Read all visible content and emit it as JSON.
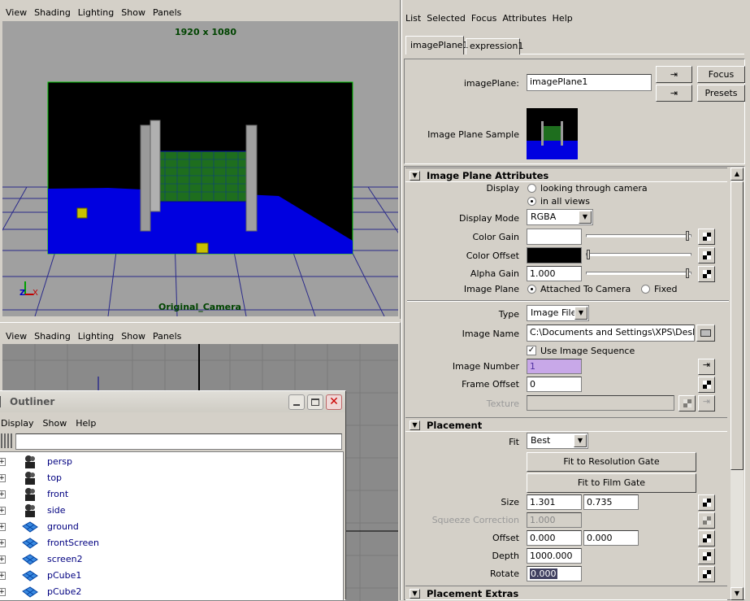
{
  "top_viewport": {
    "menu": [
      "View",
      "Shading",
      "Lighting",
      "Show",
      "Panels"
    ],
    "resolution": "1920 x 1080",
    "camera": "Original_Camera",
    "axis_z": "Z",
    "axis_x": "X"
  },
  "bottom_viewport": {
    "menu": [
      "View",
      "Shading",
      "Lighting",
      "Show",
      "Panels"
    ]
  },
  "outliner": {
    "title": "Outliner",
    "menu": [
      "Display",
      "Show",
      "Help"
    ],
    "filter": "",
    "items": [
      {
        "label": "persp",
        "icon": "camera-icon"
      },
      {
        "label": "top",
        "icon": "camera-icon"
      },
      {
        "label": "front",
        "icon": "camera-icon"
      },
      {
        "label": "side",
        "icon": "camera-icon"
      },
      {
        "label": "ground",
        "icon": "mesh-icon"
      },
      {
        "label": "frontScreen",
        "icon": "mesh-icon"
      },
      {
        "label": "screen2",
        "icon": "mesh-icon"
      },
      {
        "label": "pCube1",
        "icon": "mesh-icon"
      },
      {
        "label": "pCube2",
        "icon": "mesh-icon"
      }
    ]
  },
  "ae": {
    "menu": [
      "List",
      "Selected",
      "Focus",
      "Attributes",
      "Help"
    ],
    "tabs": [
      "imagePlane1",
      "expression1"
    ],
    "imageplane_label": "imagePlane:",
    "imageplane_value": "imagePlane1",
    "focus": "Focus",
    "presets": "Presets",
    "sample_label": "Image Plane Sample",
    "sections": {
      "attrs": "Image Plane Attributes",
      "placement": "Placement",
      "extras": "Placement Extras"
    },
    "display_label": "Display",
    "display_opt1": "looking through camera",
    "display_opt2": "in all views",
    "display_mode_label": "Display Mode",
    "display_mode": "RGBA",
    "color_gain_label": "Color Gain",
    "color_offset_label": "Color Offset",
    "alpha_gain_label": "Alpha Gain",
    "alpha_gain": "1.000",
    "image_plane_label": "Image Plane",
    "ip_opt1": "Attached To Camera",
    "ip_opt2": "Fixed",
    "type_label": "Type",
    "type_value": "Image File",
    "image_name_label": "Image Name",
    "image_name": "C:\\Documents and Settings\\XPS\\Desktop",
    "use_seq": "Use Image Sequence",
    "image_number_label": "Image Number",
    "image_number": "1",
    "frame_offset_label": "Frame Offset",
    "frame_offset": "0",
    "texture_label": "Texture",
    "fit_label": "Fit",
    "fit_value": "Best",
    "fit_res": "Fit to Resolution Gate",
    "fit_film": "Fit to Film Gate",
    "size_label": "Size",
    "size_x": "1.301",
    "size_y": "0.735",
    "squeeze_label": "Squeeze Correction",
    "squeeze": "1.000",
    "offset_label": "Offset",
    "offset_x": "0.000",
    "offset_y": "0.000",
    "depth_label": "Depth",
    "depth": "1000.000",
    "rotate_label": "Rotate",
    "rotate": "0.000"
  },
  "colors": {
    "viewport_bg": "#a0a0a0",
    "selection_green": "#00ff00",
    "outliner_text": "#000080"
  }
}
